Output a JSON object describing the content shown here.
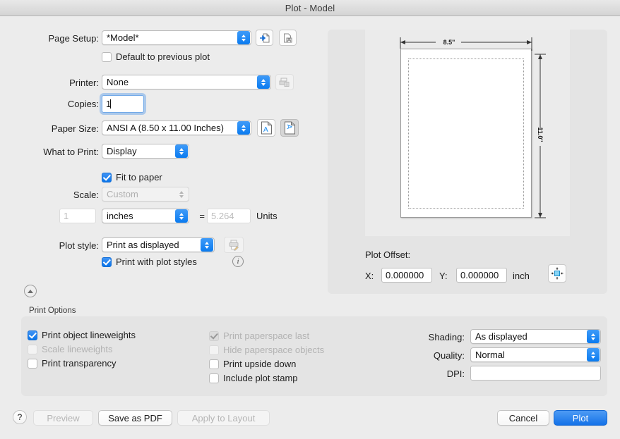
{
  "window": {
    "title": "Plot - Model"
  },
  "form": {
    "page_setup": {
      "label": "Page Setup:",
      "value": "*Model*",
      "import_icon": "import-page-setup-icon",
      "save_icon": "save-page-setup-icon",
      "default_checkbox": {
        "label": "Default to previous plot",
        "checked": false
      }
    },
    "printer": {
      "label": "Printer:",
      "value": "None",
      "setup_icon": "printer-setup-icon"
    },
    "copies": {
      "label": "Copies:",
      "value": "1"
    },
    "paper_size": {
      "label": "Paper Size:",
      "value": "ANSI A (8.50 x 11.00 Inches)",
      "portrait_icon": "portrait-orientation-icon",
      "landscape_icon": "landscape-orientation-icon",
      "selected_orientation": "landscape"
    },
    "what_to_print": {
      "label": "What to Print:",
      "value": "Display"
    },
    "fit_to_paper": {
      "label": "Fit to paper",
      "checked": true
    },
    "scale": {
      "label": "Scale:",
      "value": "Custom",
      "disabled": true
    },
    "scale_ratio": {
      "numerator": "1",
      "unit": "inches",
      "equals": "=",
      "denominator": "5.264",
      "units_label": "Units"
    },
    "plot_style": {
      "label": "Plot style:",
      "value": "Print as displayed",
      "edit_icon": "edit-plot-style-icon",
      "info_icon": "info-icon",
      "print_with_styles": {
        "label": "Print with plot styles",
        "checked": true
      }
    },
    "collapse_button": "collapse-disclosure-icon"
  },
  "preview": {
    "width_dimension": "8.5\"",
    "height_dimension": "11.0\"",
    "plot_offset": {
      "title": "Plot Offset:",
      "x_label": "X:",
      "x_value": "0.000000",
      "y_label": "Y:",
      "y_value": "0.000000",
      "unit": "inch",
      "center_icon": "center-the-plot-icon"
    }
  },
  "print_options": {
    "title": "Print Options",
    "left_column": [
      {
        "label": "Print object lineweights",
        "checked": true,
        "disabled": false
      },
      {
        "label": "Scale lineweights",
        "checked": false,
        "disabled": true
      },
      {
        "label": "Print transparency",
        "checked": false,
        "disabled": false
      }
    ],
    "middle_column": [
      {
        "label": "Print paperspace last",
        "checked": true,
        "disabled": true
      },
      {
        "label": "Hide paperspace objects",
        "checked": false,
        "disabled": true
      },
      {
        "label": "Print upside down",
        "checked": false,
        "disabled": false
      },
      {
        "label": "Include plot stamp",
        "checked": false,
        "disabled": false
      }
    ],
    "shading": {
      "label": "Shading:",
      "value": "As displayed"
    },
    "quality": {
      "label": "Quality:",
      "value": "Normal"
    },
    "dpi": {
      "label": "DPI:",
      "value": ""
    }
  },
  "footer": {
    "help": "?",
    "preview": "Preview",
    "save_as_pdf": "Save as PDF",
    "apply_to_layout": "Apply to Layout",
    "cancel": "Cancel",
    "plot": "Plot"
  },
  "colors": {
    "accent": "#0a74e8",
    "window_bg": "#ececec",
    "panel_bg": "#e4e4e4"
  }
}
